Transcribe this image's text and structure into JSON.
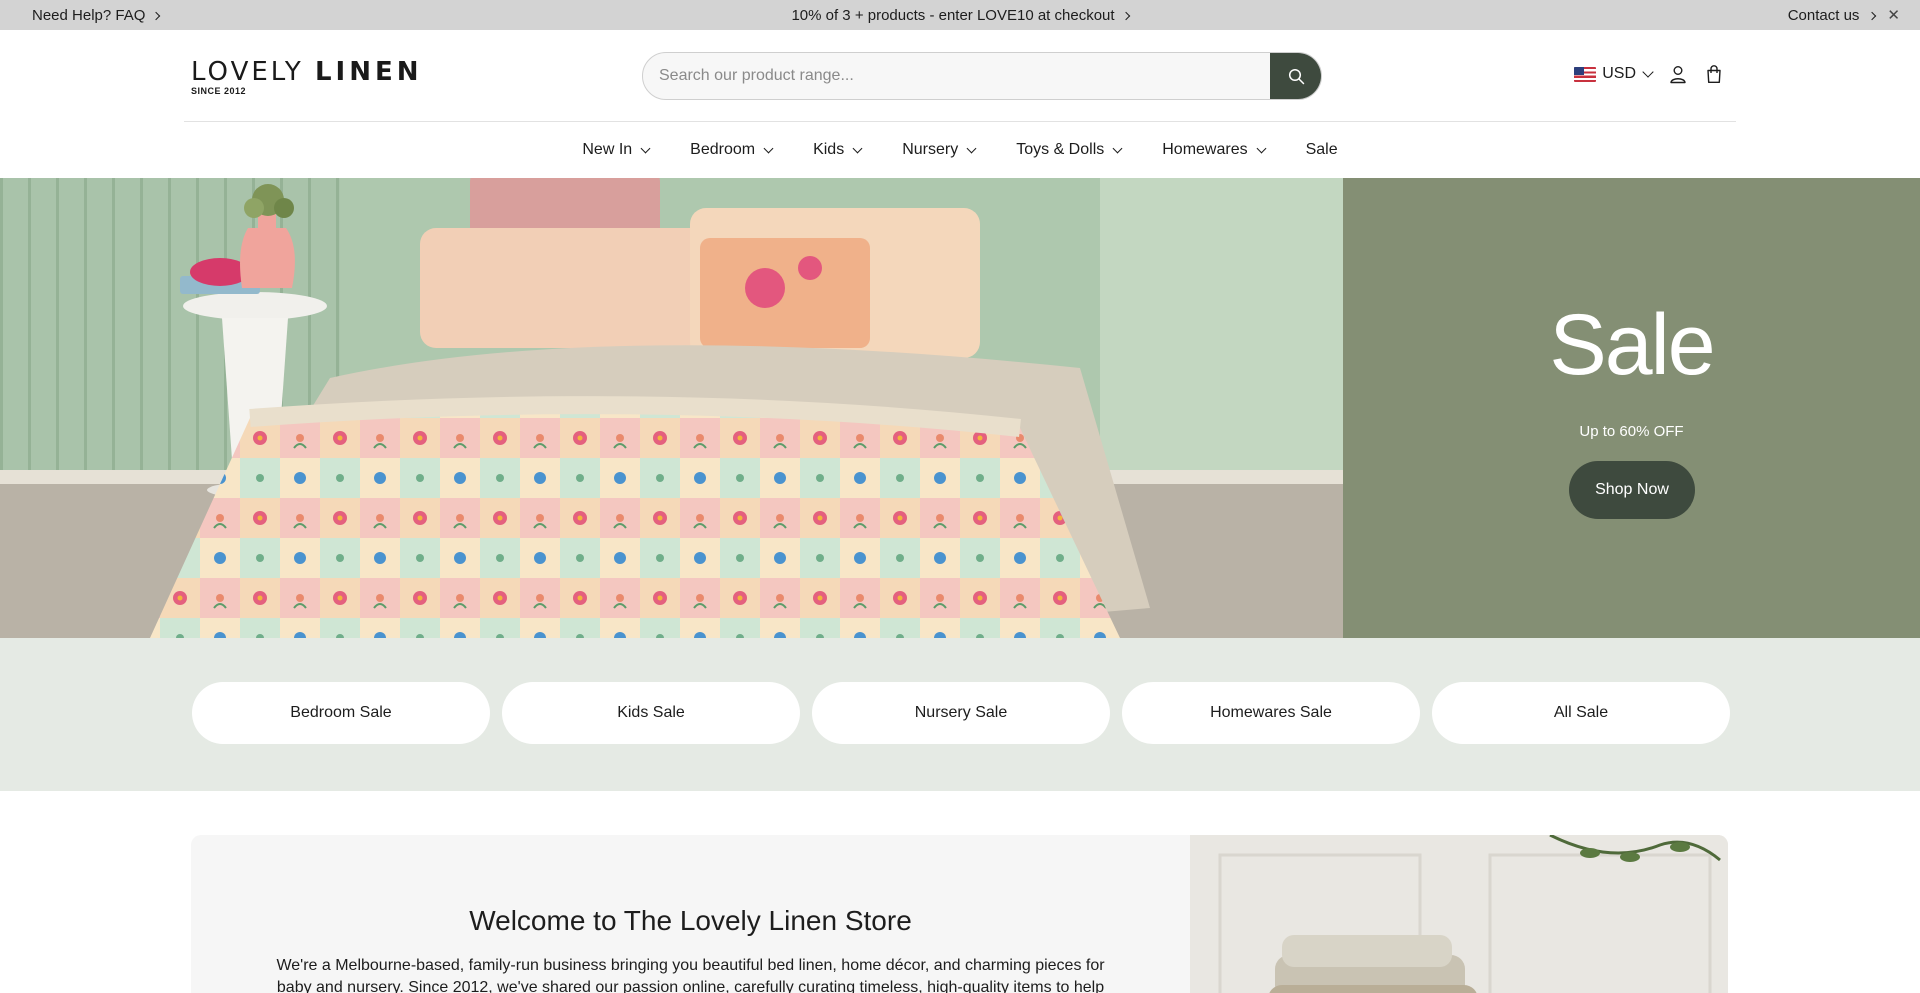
{
  "announcement": {
    "left_text": "Need Help? FAQ",
    "center_text": "10% of 3 + products - enter LOVE10 at checkout",
    "right_text": "Contact us"
  },
  "header": {
    "logo_main_light": "LOVELY",
    "logo_main_bold": "LINEN",
    "logo_sub": "SINCE 2012",
    "search_placeholder": "Search our product range...",
    "currency": "USD"
  },
  "nav": {
    "items": [
      {
        "label": "New In"
      },
      {
        "label": "Bedroom"
      },
      {
        "label": "Kids"
      },
      {
        "label": "Nursery"
      },
      {
        "label": "Toys & Dolls"
      },
      {
        "label": "Homewares"
      },
      {
        "label": "Sale"
      }
    ]
  },
  "hero": {
    "title": "Sale",
    "subtitle": "Up to 60% OFF",
    "cta": "Shop Now"
  },
  "categories": [
    {
      "label": "Bedroom Sale"
    },
    {
      "label": "Kids Sale"
    },
    {
      "label": "Nursery Sale"
    },
    {
      "label": "Homewares Sale"
    },
    {
      "label": "All Sale"
    }
  ],
  "welcome": {
    "title": "Welcome to The Lovely Linen Store",
    "text": "We're a Melbourne-based, family-run business bringing you beautiful bed linen, home décor, and charming pieces for baby and nursery. Since 2012, we've shared our passion online, carefully curating timeless, high-quality items to help you"
  },
  "colors": {
    "accent_dark_green": "#3e4a3e",
    "hero_panel": "#848f74",
    "category_band": "#e5eae4",
    "announcement_bg": "#d3d3d3"
  }
}
